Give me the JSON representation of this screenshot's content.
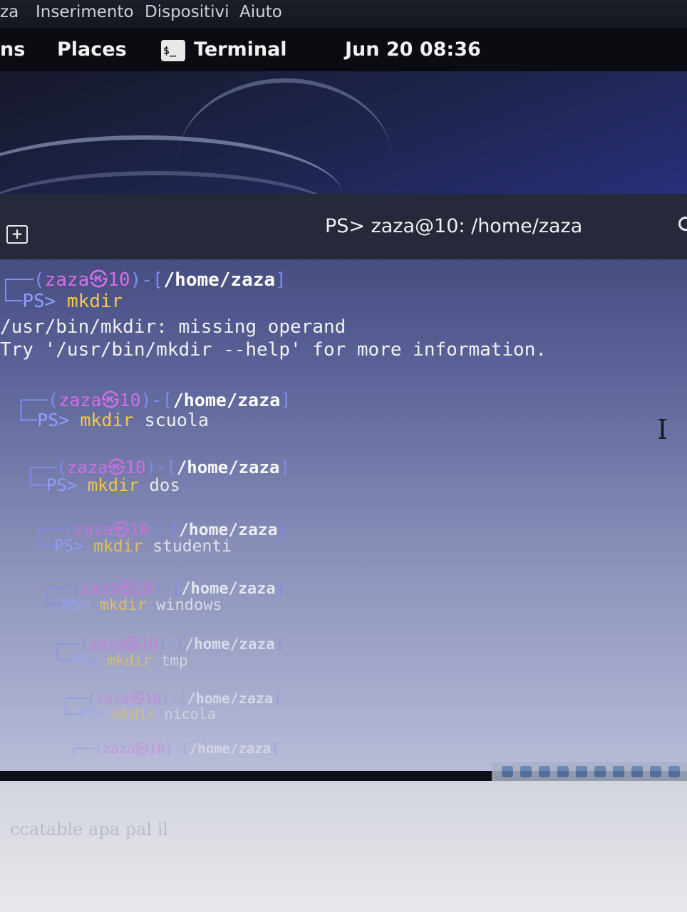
{
  "vbox_menu": [
    "za",
    "Inserimento",
    "Dispositivi",
    "Aiuto"
  ],
  "topbar": {
    "activities_fragment": "ns",
    "places": "Places",
    "app_icon_glyph": "$_",
    "app_name": "Terminal",
    "clock": "Jun 20  08:36"
  },
  "terminal": {
    "title": "PS> zaza@10: /home/zaza",
    "header_prompt": {
      "box_top": "┌──(",
      "user": "zaza㉿10",
      "sep": ")-[",
      "path": "/home/zaza",
      "close": "]",
      "box_bottom": "└─",
      "ps": "PS>",
      "cmd": "mkdir"
    },
    "output": [
      "/usr/bin/mkdir: missing operand",
      "Try '/usr/bin/mkdir --help' for more information."
    ],
    "prompts": [
      {
        "user": "zaza㉿10",
        "path": "/home/zaza",
        "ps": "PS>",
        "cmd": "mkdir",
        "arg": "scuola"
      },
      {
        "user": "zaza㉿10",
        "path": "/home/zaza",
        "ps": "PS>",
        "cmd": "mkdir",
        "arg": "dos"
      },
      {
        "user": "zaza㉿10",
        "path": "/home/zaza",
        "ps": "PS>",
        "cmd": "mkdir",
        "arg": "studenti"
      },
      {
        "user": "zaza㉿10",
        "path": "/home/zaza",
        "ps": "PS>",
        "cmd": "mkdir",
        "arg": "windows"
      },
      {
        "user": "zaza㉿10",
        "path": "/home/zaza",
        "ps": "PS>",
        "cmd": "mkdir",
        "arg": "tmp"
      },
      {
        "user": "zaza㉿10",
        "path": "/home/zaza",
        "ps": "PS>",
        "cmd": "mkdir",
        "arg": "nicola"
      },
      {
        "user": "zaza㉿10",
        "path": "/home/zaza",
        "ps": "",
        "cmd": "",
        "arg": ""
      }
    ],
    "cursor_icon": "I-beam"
  },
  "bottom_text": "ccatable   apa   pal   il",
  "colors": {
    "user": "#d46ee8",
    "box": "#7f8cf0",
    "command": "#f3c94a",
    "path": "#ffffff"
  }
}
